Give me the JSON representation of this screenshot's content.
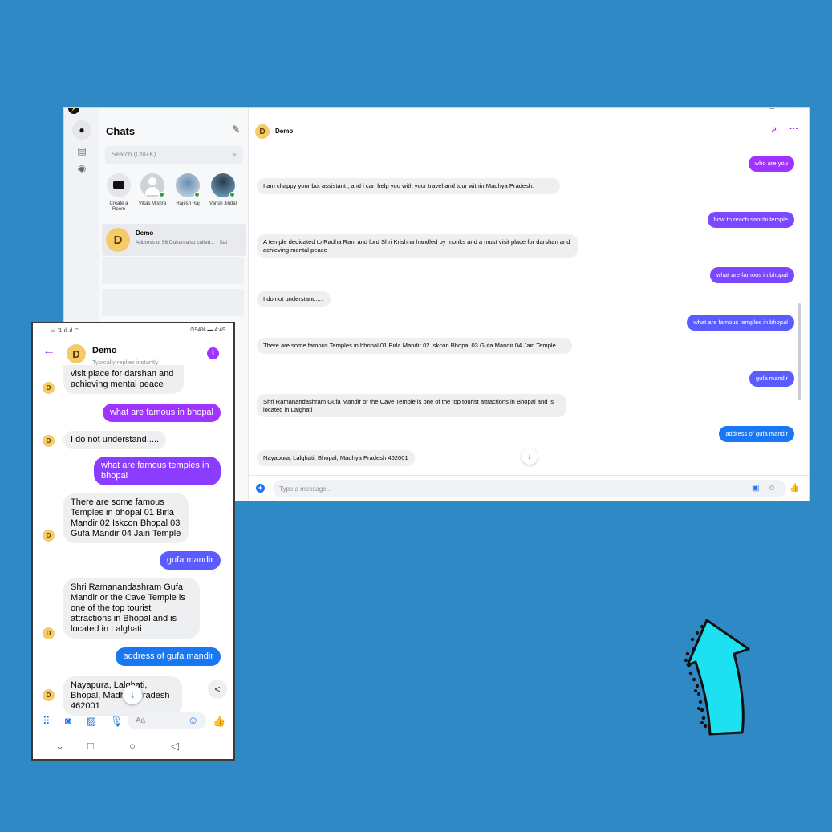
{
  "desktop": {
    "sidebar": {
      "title": "Chats",
      "search_placeholder": "Search (Ctrl+K)",
      "stories": [
        {
          "label": "Create a Room"
        },
        {
          "label": "Vikas Mishra"
        },
        {
          "label": "Rajesh Raj"
        },
        {
          "label": "Vansh Jindal"
        }
      ],
      "conversation": {
        "avatar_letter": "D",
        "name": "Demo",
        "preview": "Address of 56 Dukan also called...",
        "time": "· Sat"
      }
    },
    "header": {
      "avatar_letter": "D",
      "name": "Demo"
    },
    "messages": [
      {
        "dir": "out",
        "text": "who are you"
      },
      {
        "dir": "in",
        "text": "I am chappy your bot assistant , and i can help you with your travel and tour within Madhya Pradesh."
      },
      {
        "dir": "out",
        "text": "how to reach sanchi temple"
      },
      {
        "dir": "in",
        "text": "A temple dedicated to Radha Rani and lord Shri Krishna handled by monks and a must visit place for darshan and achieving mental peace"
      },
      {
        "dir": "out",
        "text": "what are famous in bhopal"
      },
      {
        "dir": "in",
        "text": "I do not understand....."
      },
      {
        "dir": "out",
        "text": "what are famous temples in bhopal"
      },
      {
        "dir": "in",
        "text": "There are some famous Temples in bhopal 01 Birla Mandir 02 Iskcon Bhopal 03 Gufa Mandir 04 Jain Temple"
      },
      {
        "dir": "out",
        "text": "gufa mandir"
      },
      {
        "dir": "in",
        "text": "Shri Ramanandashram Gufa Mandir or the Cave Temple is one of the top tourist attractions in Bhopal and is located in Lalghati"
      },
      {
        "dir": "out",
        "text": "address of gufa mandir"
      },
      {
        "dir": "in",
        "text": "Nayapura, Lalghati, Bhopal, Madhya Pradesh 462001"
      }
    ],
    "composer_placeholder": "Type a message..."
  },
  "phone": {
    "status": {
      "left": "▭ ⇅.ıl .ıl ⌔",
      "right": "⏱94% ▬ 4:49"
    },
    "header": {
      "avatar_letter": "D",
      "name": "Demo",
      "subtitle": "Typically replies instantly"
    },
    "messages": [
      {
        "dir": "in",
        "text": "visit place for darshan and achieving mental peace"
      },
      {
        "dir": "out",
        "text": "what are famous in bhopal"
      },
      {
        "dir": "in",
        "text": "I do not understand....."
      },
      {
        "dir": "out",
        "text": "what are famous temples in bhopal"
      },
      {
        "dir": "in",
        "text": "There are some famous Temples in bhopal 01 Birla Mandir 02 Iskcon Bhopal 03 Gufa Mandir 04 Jain Temple"
      },
      {
        "dir": "out",
        "text": "gufa mandir"
      },
      {
        "dir": "in",
        "text": "Shri Ramanandashram Gufa Mandir or the Cave Temple is one of the top tourist attractions in Bhopal and is located in Lalghati"
      },
      {
        "dir": "out",
        "text": "address of gufa mandir"
      },
      {
        "dir": "in",
        "text": "Nayapura, Lalghati, Bhopal, Madhya Pradesh 462001"
      }
    ],
    "composer_placeholder": "Aa"
  },
  "colors": {
    "background": "#2e89c4",
    "arrow": "#1de0f0",
    "accent": "#a033ff",
    "messenger_blue": "#1877f2"
  },
  "decoration": {
    "arrow_icon": "curved-up-arrow-icon"
  }
}
